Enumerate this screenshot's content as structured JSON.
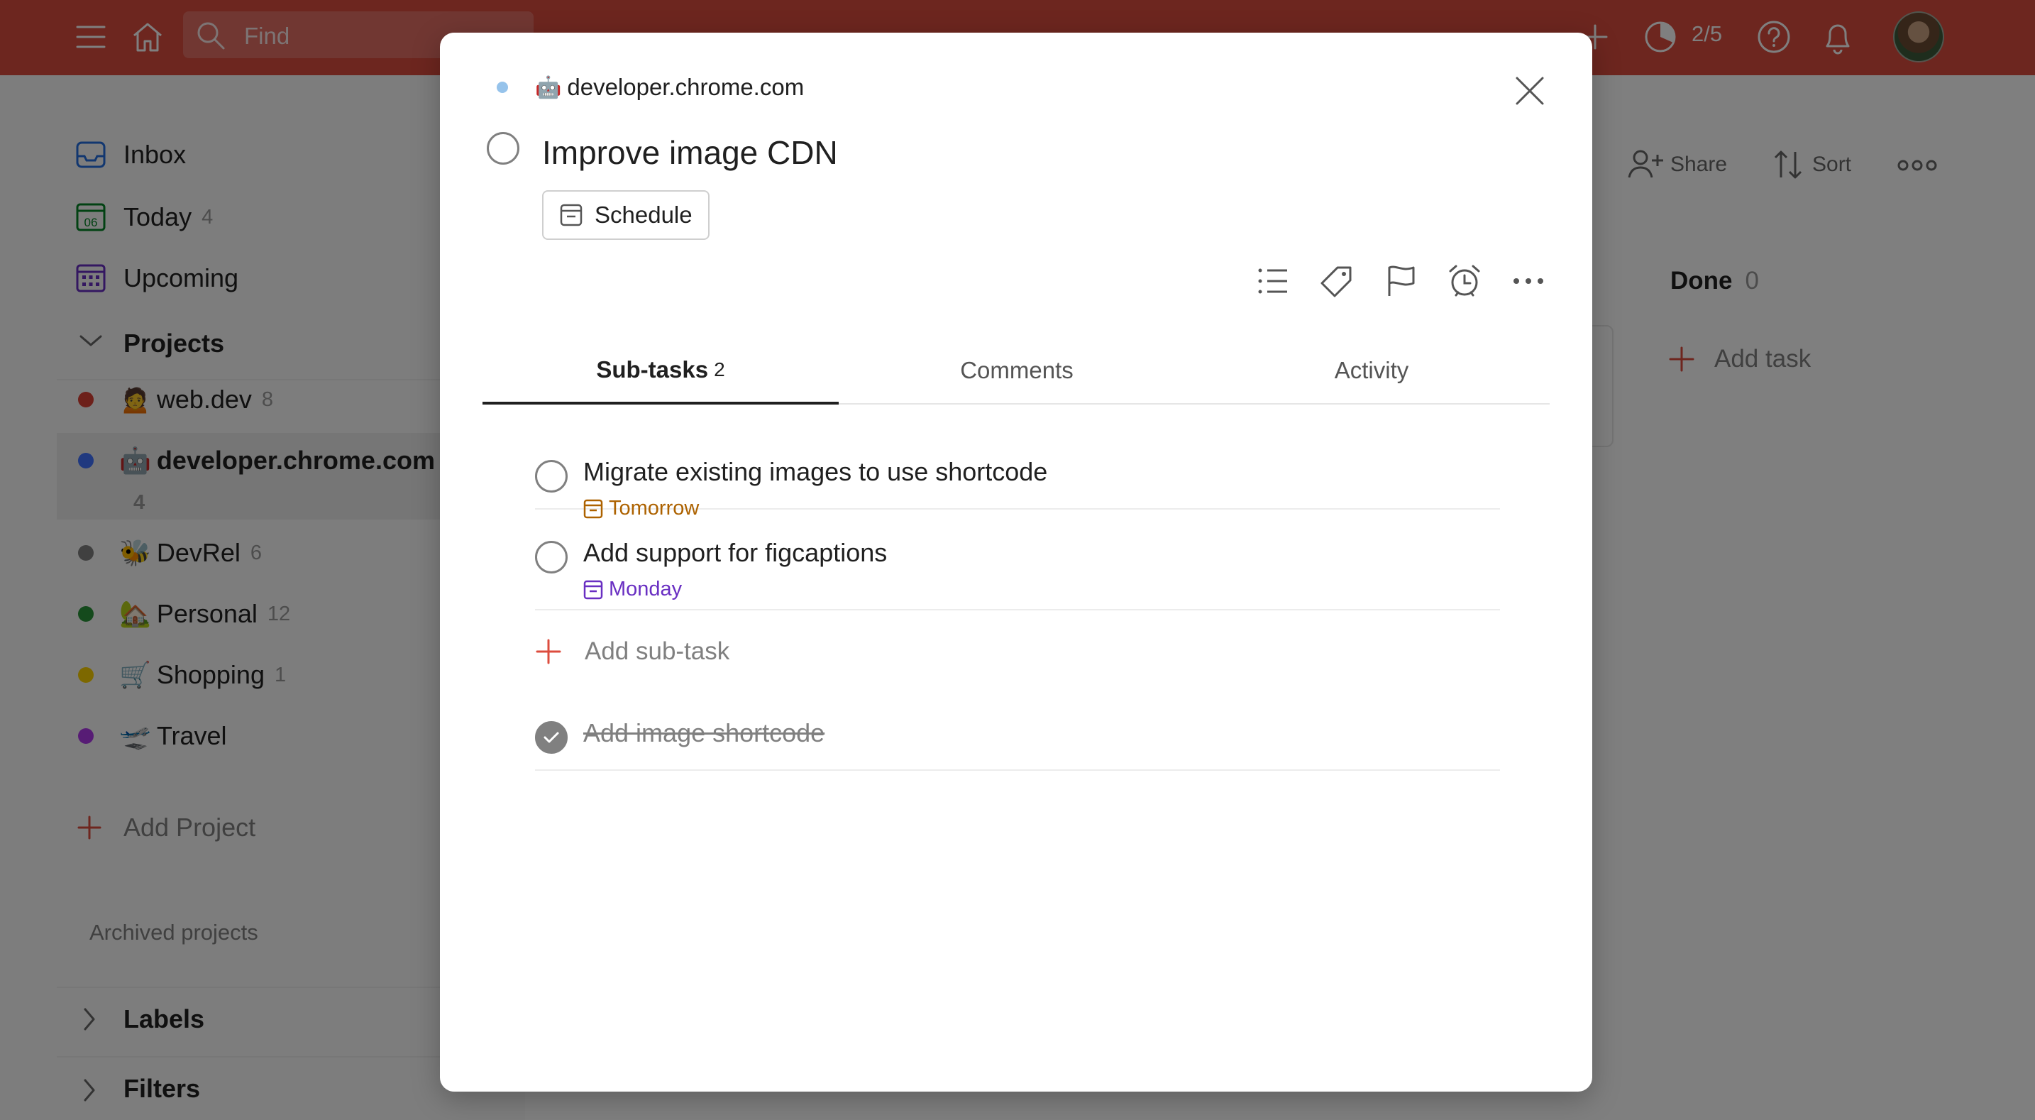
{
  "topbar": {
    "search_placeholder": "Find",
    "karma": "2/5",
    "icons": [
      "menu-icon",
      "home-icon",
      "search-icon",
      "add-icon",
      "productivity-icon",
      "help-icon",
      "bell-icon"
    ]
  },
  "sidebar": {
    "inbox": "Inbox",
    "today": "Today",
    "today_count": "4",
    "today_icon_day": "06",
    "upcoming": "Upcoming",
    "projects_title": "Projects",
    "projects": [
      {
        "emoji": "🙍",
        "name": "web.dev",
        "count": "8",
        "color": "#db4035"
      },
      {
        "emoji": "🤖",
        "name": "developer.chrome.com",
        "count": "4",
        "color": "#4073ff"
      },
      {
        "emoji": "🐝",
        "name": "DevRel",
        "count": "6",
        "color": "#808080"
      },
      {
        "emoji": "🏡",
        "name": "Personal",
        "count": "12",
        "color": "#299438"
      },
      {
        "emoji": "🛒",
        "name": "Shopping",
        "count": "1",
        "color": "#fad000"
      },
      {
        "emoji": "🛫",
        "name": "Travel",
        "count": "",
        "color": "#af38eb"
      }
    ],
    "add_project": "Add Project",
    "archived": "Archived projects",
    "labels": "Labels",
    "filters": "Filters"
  },
  "main": {
    "share": "Share",
    "sort": "Sort",
    "done_title": "Done",
    "done_count": "0",
    "add_task": "Add task"
  },
  "modal": {
    "project_emoji": "🤖",
    "project_name": "developer.chrome.com",
    "task_title": "Improve image CDN",
    "schedule_label": "Schedule",
    "tabs": [
      {
        "label": "Sub-tasks",
        "count": "2"
      },
      {
        "label": "Comments",
        "count": ""
      },
      {
        "label": "Activity",
        "count": ""
      }
    ],
    "subtasks": [
      {
        "title": "Migrate existing images to use shortcode",
        "date": "Tomorrow",
        "date_color": "#ad6200",
        "done": false
      },
      {
        "title": "Add support for figcaptions",
        "date": "Monday",
        "date_color": "#692fc2",
        "done": false
      }
    ],
    "add_subtask": "Add sub-task",
    "completed": [
      {
        "title": "Add image shortcode",
        "done": true
      }
    ]
  },
  "colors": {
    "brand_red": "#db4c3f",
    "accent_red": "#dc4c3e"
  }
}
